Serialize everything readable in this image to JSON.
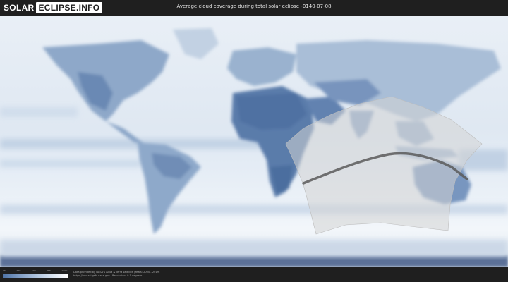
{
  "header": {
    "logo_part1": "SOLAR",
    "logo_part2": "ECLIPSE.INFO",
    "title": "Average cloud coverage during total solar eclipse -0140-07-08"
  },
  "map": {
    "projection": "equirectangular",
    "land_color": "#4d6f9e",
    "cloud_color": "#ffffff",
    "eclipse_zone_color": "#d4d4d4",
    "path_of_totality_color": "#5a5a5a"
  },
  "legend": {
    "ticks": [
      "0%",
      "25%",
      "50%",
      "75%",
      "100%"
    ]
  },
  "footer": {
    "credit_line1": "Data provided by NASA's Aqua & Terra satellite (Years: 2000 - 2019)",
    "credit_line2": "https://neo.sci.gsfc.nasa.gov | Resolution: 0.1 degrees"
  }
}
